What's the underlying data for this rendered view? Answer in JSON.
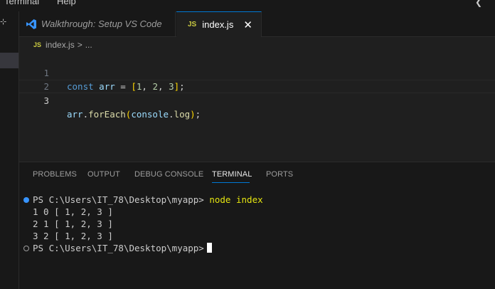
{
  "menubar": {
    "items": [
      "Terminal",
      "Help"
    ]
  },
  "tabs": [
    {
      "label": "Walkthrough: Setup VS Code",
      "icon": "vscode-logo-icon",
      "active": false
    },
    {
      "label": "index.js",
      "icon": "js-file-icon",
      "badge": "JS",
      "active": true,
      "close": "✕"
    }
  ],
  "breadcrumb": {
    "badge": "JS",
    "file": "index.js",
    "separator": ">",
    "rest": "..."
  },
  "editor": {
    "lines": [
      {
        "number": "1"
      },
      {
        "number": "2"
      },
      {
        "number": "3"
      }
    ],
    "code": {
      "line1": {
        "kw": "const",
        "var": "arr",
        "op": "=",
        "open": "[",
        "n1": "1",
        "n2": "2",
        "n3": "3",
        "close": "]",
        "semi": ";"
      },
      "line3": {
        "obj": "arr",
        "dot1": ".",
        "method": "forEach",
        "open": "(",
        "arg_obj": "console",
        "dot2": ".",
        "arg_fn": "log",
        "close": ")",
        "semi": ";"
      }
    }
  },
  "panel": {
    "tabs": [
      "PROBLEMS",
      "OUTPUT",
      "DEBUG CONSOLE",
      "TERMINAL",
      "PORTS"
    ],
    "active_tab": "TERMINAL"
  },
  "terminal": {
    "prompt": "PS C:\\Users\\IT_78\\Desktop\\myapp>",
    "command": "node index",
    "output": [
      "1 0 [ 1, 2, 3 ]",
      "2 1 [ 1, 2, 3 ]",
      "3 2 [ 1, 2, 3 ]"
    ],
    "prompt2": "PS C:\\Users\\IT_78\\Desktop\\myapp>"
  },
  "colors": {
    "accent": "#0078d4",
    "js_badge": "#cbcb41",
    "terminal_command": "#e5e510",
    "success_dot": "#3794ff"
  }
}
